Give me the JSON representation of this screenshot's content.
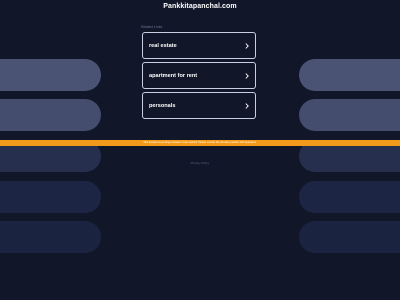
{
  "header": {
    "site_title": "Pankkitapanchal.com"
  },
  "related": {
    "label": "Related Links",
    "links": [
      {
        "label": "real estate"
      },
      {
        "label": "apartment for rent"
      },
      {
        "label": "personals"
      }
    ]
  },
  "banner": {
    "text": "This domain is pending renewal or has expired. Please contact the domain provider with questions."
  },
  "footer": {
    "privacy": "Privacy Policy"
  },
  "colors": {
    "background": "#111729",
    "banner": "#f29a1a",
    "pill_light": "#4a5373",
    "pill_dark": "#1c2543"
  },
  "icons": {
    "link_arrow": "chevron-right-icon"
  }
}
